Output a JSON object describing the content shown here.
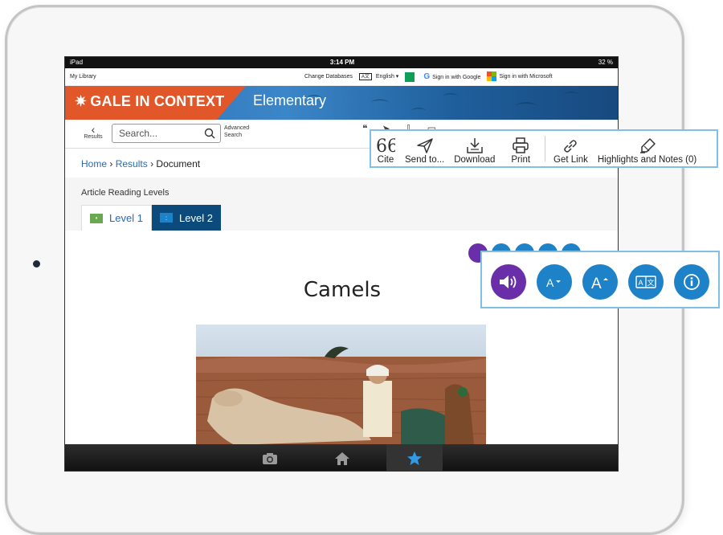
{
  "status_bar": {
    "device": "iPad",
    "time": "3:14 PM",
    "battery": "32 %"
  },
  "util_bar": {
    "my_library": "My Library",
    "change_databases": "Change Databases",
    "language": "English",
    "sign_in_google": "Sign in with Google",
    "sign_in_microsoft": "Sign in with Microsoft"
  },
  "banner": {
    "brand": "GALE IN CONTEXT",
    "product": "Elementary"
  },
  "toolbar": {
    "back_label": "Results",
    "search_placeholder": "Search...",
    "advanced_search_line1": "Advanced",
    "advanced_search_line2": "Search"
  },
  "breadcrumb": {
    "home": "Home",
    "sep1": "›",
    "results": "Results",
    "sep2": "›",
    "current": "Document"
  },
  "reading_levels": {
    "title": "Article Reading Levels",
    "tabs": [
      {
        "label": "Level 1",
        "color": "#6aa84f"
      },
      {
        "label": "Level 2",
        "color": "#1e82c8"
      }
    ]
  },
  "article": {
    "title": "Camels"
  },
  "tools_callout": {
    "items": [
      {
        "label": "Cite",
        "icon": "quote-icon"
      },
      {
        "label": "Send to...",
        "icon": "send-icon"
      },
      {
        "label": "Download",
        "icon": "download-icon"
      },
      {
        "label": "Print",
        "icon": "print-icon"
      },
      {
        "label": "Get Link",
        "icon": "link-icon"
      },
      {
        "label": "Highlights and Notes (0)",
        "icon": "highlighter-icon"
      }
    ]
  },
  "reader_tools": {
    "items": [
      {
        "name": "listen",
        "icon": "speaker-icon",
        "color": "#6a2fa8"
      },
      {
        "name": "decrease-font",
        "icon": "font-decrease-icon",
        "color": "#1e82c8"
      },
      {
        "name": "increase-font",
        "icon": "font-increase-icon",
        "color": "#1e82c8"
      },
      {
        "name": "translate",
        "icon": "translate-icon",
        "color": "#1e82c8"
      },
      {
        "name": "info",
        "icon": "info-icon",
        "color": "#1e82c8"
      }
    ]
  },
  "bottom_bar": {
    "items": [
      "camera-icon",
      "home-icon",
      "star-icon"
    ]
  },
  "colors": {
    "banner_orange": "#e2572a",
    "banner_blue": "#2d6fb4",
    "accent_blue": "#1e82c8",
    "accent_purple": "#6a2fa8",
    "callout_border": "#7fc0e6"
  }
}
